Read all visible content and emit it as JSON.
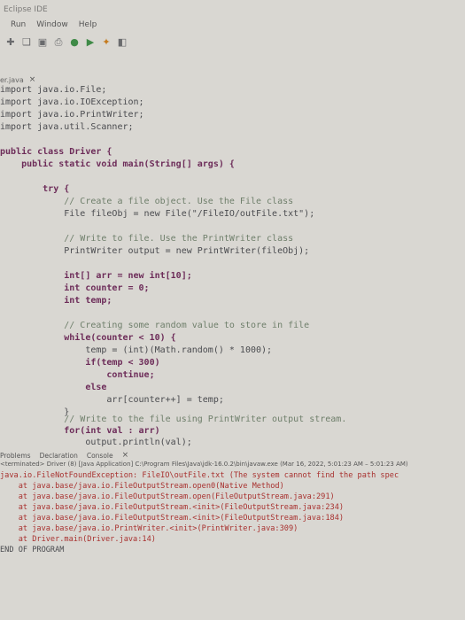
{
  "window": {
    "title": "Eclipse IDE"
  },
  "menu": [
    "Run",
    "Window",
    "Help"
  ],
  "toolbar": {
    "icons": [
      {
        "name": "new-icon"
      },
      {
        "name": "open-icon"
      },
      {
        "name": "save-icon"
      },
      {
        "name": "print-icon"
      },
      {
        "name": "debug-icon"
      },
      {
        "name": "run-icon"
      },
      {
        "name": "external-tools-icon"
      },
      {
        "name": "new-java-class-icon"
      }
    ]
  },
  "editor_tab": {
    "label": "er.java",
    "close": "×"
  },
  "code": {
    "line0": "import java.io.File;",
    "line1": "import java.io.IOException;",
    "line2": "import java.io.PrintWriter;",
    "line3": "import java.util.Scanner;",
    "line4": "public class Driver {",
    "line5": "    public static void main(String[] args) {",
    "line6": "        try {",
    "line7": "            // Create a file object. Use the File class",
    "line8": "            File fileObj = new File(\"/FileIO/outFile.txt\");",
    "line9": "            // Write to file. Use the PrintWriter class",
    "line10": "            PrintWriter output = new PrintWriter(fileObj);",
    "line11": "            int[] arr = new int[10];",
    "line12": "            int counter = 0;",
    "line13": "            int temp;",
    "line14": "            // Creating some random value to store in file",
    "line15": "            while(counter < 10) {",
    "line16": "                temp = (int)(Math.random() * 1000);",
    "line17": "                if(temp < 300)",
    "line18": "                    continue;",
    "line19": "                else",
    "line20": "                    arr[counter++] = temp;",
    "line21": "            }",
    "line22": "            // Write to the file using PrintWriter output stream.",
    "line23": "            for(int val : arr)",
    "line24": "                output.println(val);"
  },
  "panel_tabs": {
    "problems": "Problems",
    "declaration": "Declaration",
    "console": "Console"
  },
  "console": {
    "status": "<terminated> Driver (8) [Java Application] C:\\Program Files\\Java\\jdk-16.0.2\\bin\\javaw.exe (Mar 16, 2022, 5:01:23 AM – 5:01:23 AM)",
    "lines": [
      "java.io.FileNotFoundException: FileIO\\outFile.txt (The system cannot find the path spec",
      "    at java.base/java.io.FileOutputStream.open0(Native Method)",
      "    at java.base/java.io.FileOutputStream.open(FileOutputStream.java:291)",
      "    at java.base/java.io.FileOutputStream.<init>(FileOutputStream.java:234)",
      "    at java.base/java.io.FileOutputStream.<init>(FileOutputStream.java:184)",
      "    at java.base/java.io.PrintWriter.<init>(PrintWriter.java:309)",
      "    at Driver.main(Driver.java:14)"
    ],
    "end": "END OF PROGRAM"
  }
}
